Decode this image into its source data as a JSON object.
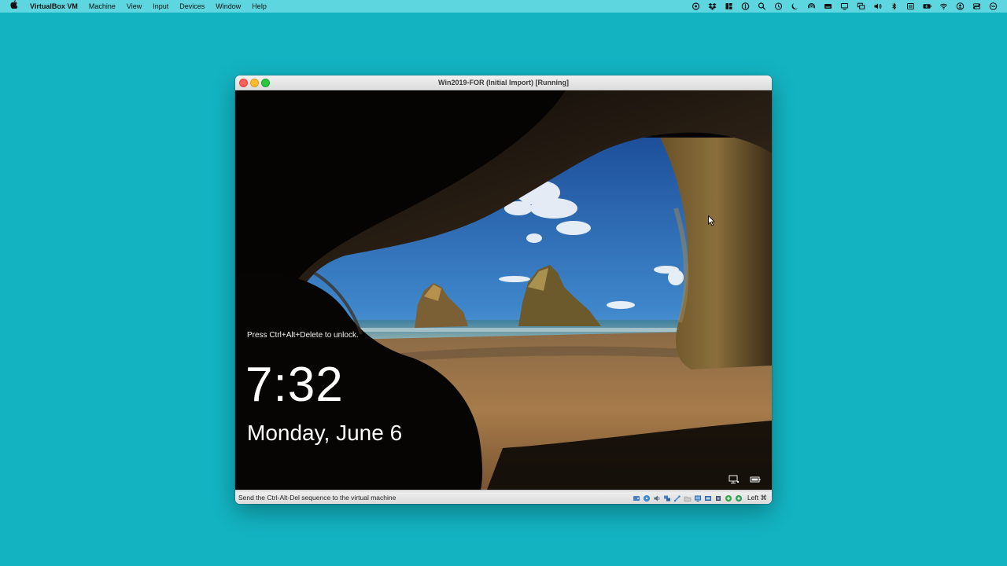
{
  "menubar": {
    "app_name": "VirtualBox VM",
    "menus": [
      "Machine",
      "View",
      "Input",
      "Devices",
      "Window",
      "Help"
    ]
  },
  "window": {
    "title": "Win2019-FOR (Initial Import) [Running]"
  },
  "lockscreen": {
    "hint": "Press Ctrl+Alt+Delete to unlock.",
    "time": "7:32",
    "date": "Monday, June 6"
  },
  "statusbar": {
    "text": "Send the Ctrl-Alt-Del sequence to the virtual machine",
    "host_key": "Left ⌘"
  },
  "colors": {
    "desktop": "#13b3c2",
    "menubar": "#5dd6e0"
  }
}
